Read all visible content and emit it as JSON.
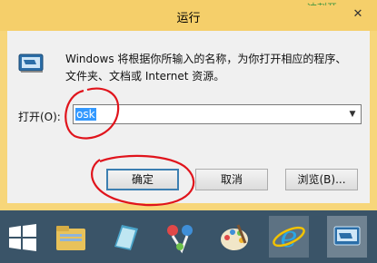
{
  "window": {
    "title": "运行",
    "close_glyph": "✕",
    "background_overlay_text": "冲刺开"
  },
  "run": {
    "icon": "run-dialog-icon",
    "description_line1": "Windows 将根据你所输入的名称，为你打开相应的程序、",
    "description_line2": "文件夹、文档或 Internet 资源。",
    "open_label": "打开(O):",
    "open_value": "osk",
    "ok_label": "确定",
    "cancel_label": "取消",
    "browse_label": "浏览(B)..."
  },
  "annotations": {
    "color": "#e0141c",
    "marks": [
      "circle-around-open-value",
      "circle-around-ok-button"
    ]
  },
  "taskbar": {
    "items": [
      {
        "name": "start-button",
        "icon": "windows-logo-icon"
      },
      {
        "name": "file-explorer",
        "icon": "folder-icon"
      },
      {
        "name": "notepad",
        "icon": "notepad-icon"
      },
      {
        "name": "paint-tool",
        "icon": "scissors-paint-icon"
      },
      {
        "name": "paint",
        "icon": "palette-icon"
      },
      {
        "name": "internet-explorer",
        "icon": "ie-icon"
      },
      {
        "name": "run",
        "icon": "run-dialog-icon"
      }
    ]
  },
  "colors": {
    "title_bar": "#f5cf6a",
    "selection": "#3399ff",
    "default_button_border": "#3c7fb1",
    "taskbar": "#3a5468"
  }
}
